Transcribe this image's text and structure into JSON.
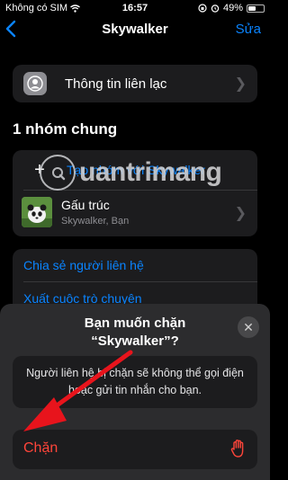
{
  "status_bar": {
    "carrier": "Không có SIM",
    "time": "16:57",
    "battery": "49%",
    "battery_level": 0.49
  },
  "nav": {
    "title": "Skywalker",
    "edit_label": "Sửa"
  },
  "contact_info": {
    "label": "Thông tin liên lạc"
  },
  "groups_section": {
    "title": "1 nhóm chung",
    "add_label": "Tạo nhóm với Skywalker",
    "group": {
      "name": "Gấu trúc",
      "members": "Skywalker, Bạn"
    }
  },
  "actions": {
    "share_contact": "Chia sẻ người liên hệ",
    "export_chat": "Xuất cuộc trò chuyện"
  },
  "watermark": {
    "text": "uantrimang"
  },
  "block_sheet": {
    "title_line1": "Bạn muốn chặn",
    "title_line2": "“Skywalker”?",
    "message_line1": "Người liên hệ bị chặn sẽ không thể gọi điện",
    "message_line2": "hoặc gửi tin nhắn cho bạn.",
    "block_label": "Chặn"
  },
  "colors": {
    "accent": "#0a84ff",
    "destructive": "#ff453a",
    "annotation_arrow": "#e8141c"
  },
  "icons": {
    "back": "chevron-left-icon",
    "contact": "person-circle-icon",
    "add": "plus-icon",
    "close": "close-icon",
    "block": "hand-raised-icon"
  }
}
